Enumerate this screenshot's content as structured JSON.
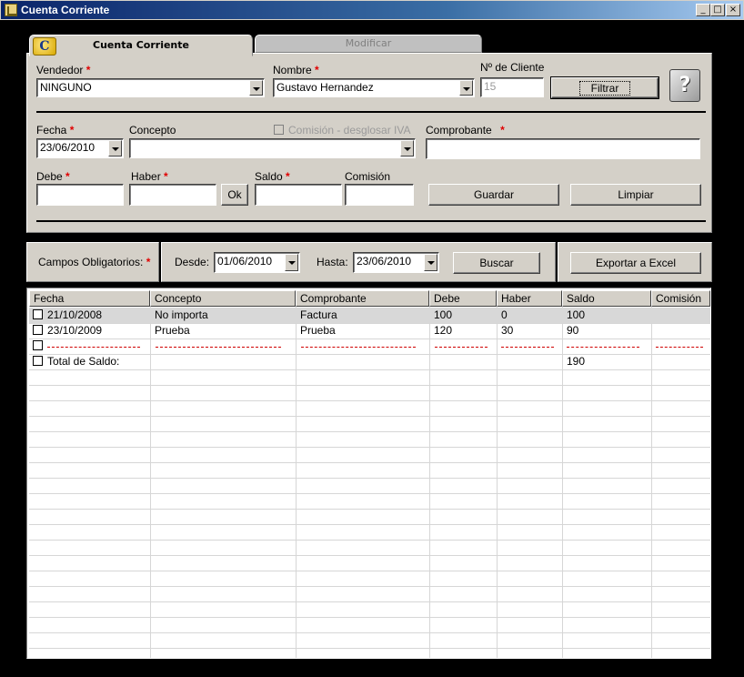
{
  "window": {
    "title": "Cuenta Corriente",
    "controls": [
      "_",
      "□",
      "×"
    ]
  },
  "tabs": [
    {
      "label": "Cuenta Corriente",
      "active": true
    },
    {
      "label": "Modificar",
      "active": false
    }
  ],
  "tab_logo": "C",
  "form": {
    "vendedor": {
      "label": "Vendedor",
      "value": "NINGUNO"
    },
    "nombre": {
      "label": "Nombre",
      "value": "Gustavo Hernandez"
    },
    "nro_cliente": {
      "label": "Nº de Cliente",
      "value": "15"
    },
    "filtrar_label": "Filtrar",
    "help_glyph": "?",
    "fecha": {
      "label": "Fecha",
      "value": "23/06/2010"
    },
    "concepto": {
      "label": "Concepto",
      "value": ""
    },
    "comision_iva_label": "Comisión - desglosar IVA",
    "comprobante": {
      "label": "Comprobante",
      "value": ""
    },
    "debe": {
      "label": "Debe",
      "value": ""
    },
    "haber": {
      "label": "Haber",
      "value": ""
    },
    "ok_label": "Ok",
    "saldo": {
      "label": "Saldo",
      "value": ""
    },
    "comision": {
      "label": "Comisión",
      "value": ""
    },
    "guardar_label": "Guardar",
    "limpiar_label": "Limpiar",
    "required_mark": "*"
  },
  "filter": {
    "campos_label": "Campos Obligatorios:",
    "desde_label": "Desde:",
    "desde_value": "01/06/2010",
    "hasta_label": "Hasta:",
    "hasta_value": "23/06/2010",
    "buscar_label": "Buscar",
    "exportar_label": "Exportar a Excel"
  },
  "table": {
    "columns": [
      "Fecha",
      "Concepto",
      "Comprobante",
      "Debe",
      "Haber",
      "Saldo",
      "Comisión"
    ],
    "rows": [
      {
        "fecha": "21/10/2008",
        "concepto": "No importa",
        "comprobante": "Factura",
        "debe": "100",
        "haber": "0",
        "saldo": "100",
        "comision": ""
      },
      {
        "fecha": "23/10/2009",
        "concepto": "Prueba",
        "comprobante": "Prueba",
        "debe": "120",
        "haber": "30",
        "saldo": "90",
        "comision": ""
      }
    ],
    "total_label": "Total de Saldo:",
    "total_saldo": "190"
  },
  "colors": {
    "face": "#d4d0c8",
    "required": "#e00000",
    "title_gradient_start": "#0a246a"
  }
}
